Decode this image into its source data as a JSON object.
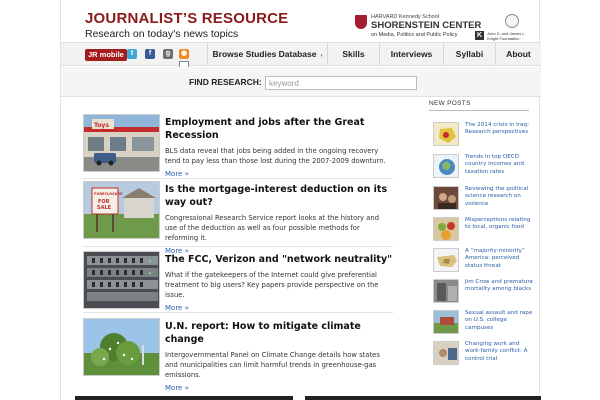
{
  "header": {
    "title": "JOURNALIST’S RESOURCE",
    "tagline": "Research on today’s news topics",
    "partner_school": "HARVARD Kennedy School",
    "partner_center": "SHORENSTEIN CENTER",
    "partner_center_sub": "on Media, Politics and Public Policy",
    "knight_text": "John S. and James L. Knight Foundation"
  },
  "nav": {
    "mobile_label": "JR mobile",
    "social_icons": [
      "twitter-icon",
      "facebook-icon",
      "google-plus-icon",
      "rss-icon",
      "email-icon"
    ],
    "items": [
      {
        "label": "Browse Studies Database",
        "has_caret": true
      },
      {
        "label": "Skills"
      },
      {
        "label": "Interviews"
      },
      {
        "label": "Syllabi"
      },
      {
        "label": "About"
      }
    ]
  },
  "search": {
    "label": "FIND RESEARCH:",
    "placeholder": "keyword"
  },
  "articles": [
    {
      "title": "Employment and jobs after the Great Recession",
      "description": "BLS data reveal that jobs being added in the ongoing recovery tend to pay less than those lost during the 2007-2009 downturn.",
      "more": "More »"
    },
    {
      "title": "Is the mortgage-interest deduction on its way out?",
      "description": "Congressional Research Service report looks at the history and use of the deduction as well as four possible methods for reforming it.",
      "more": "More »"
    },
    {
      "title": "The FCC, Verizon and \"network neutrality\"",
      "description": "What if the gatekeepers of the Internet could give preferential treatment to big users? Key papers provide perspective on the issue.",
      "more": "More »"
    },
    {
      "title": "U.N. report: How to mitigate climate change",
      "description": "Intergovernmental Panel on Climate Change details how states and municipalities can limit harmful trends in greenhouse-gas emissions.",
      "more": "More »"
    }
  ],
  "sidebar": {
    "heading": "NEW POSTS",
    "posts": [
      "The 2014 crisis in Iraq: Research perspectives",
      "Trends in top OECD country incomes and taxation rates",
      "Reviewing the political science research on violence",
      "Misperceptions relating to local, organic food",
      "A “majority-minority” America: perceived status threat",
      "Jim Crow and premature mortality among blacks",
      "Sexual assault and rape on U.S. college campuses",
      "Changing work and work-family conflict: A control trial"
    ]
  },
  "colors": {
    "brand": "#8b1a1a",
    "link": "#2a5ea8",
    "mobile_badge": "#a51c1c"
  }
}
